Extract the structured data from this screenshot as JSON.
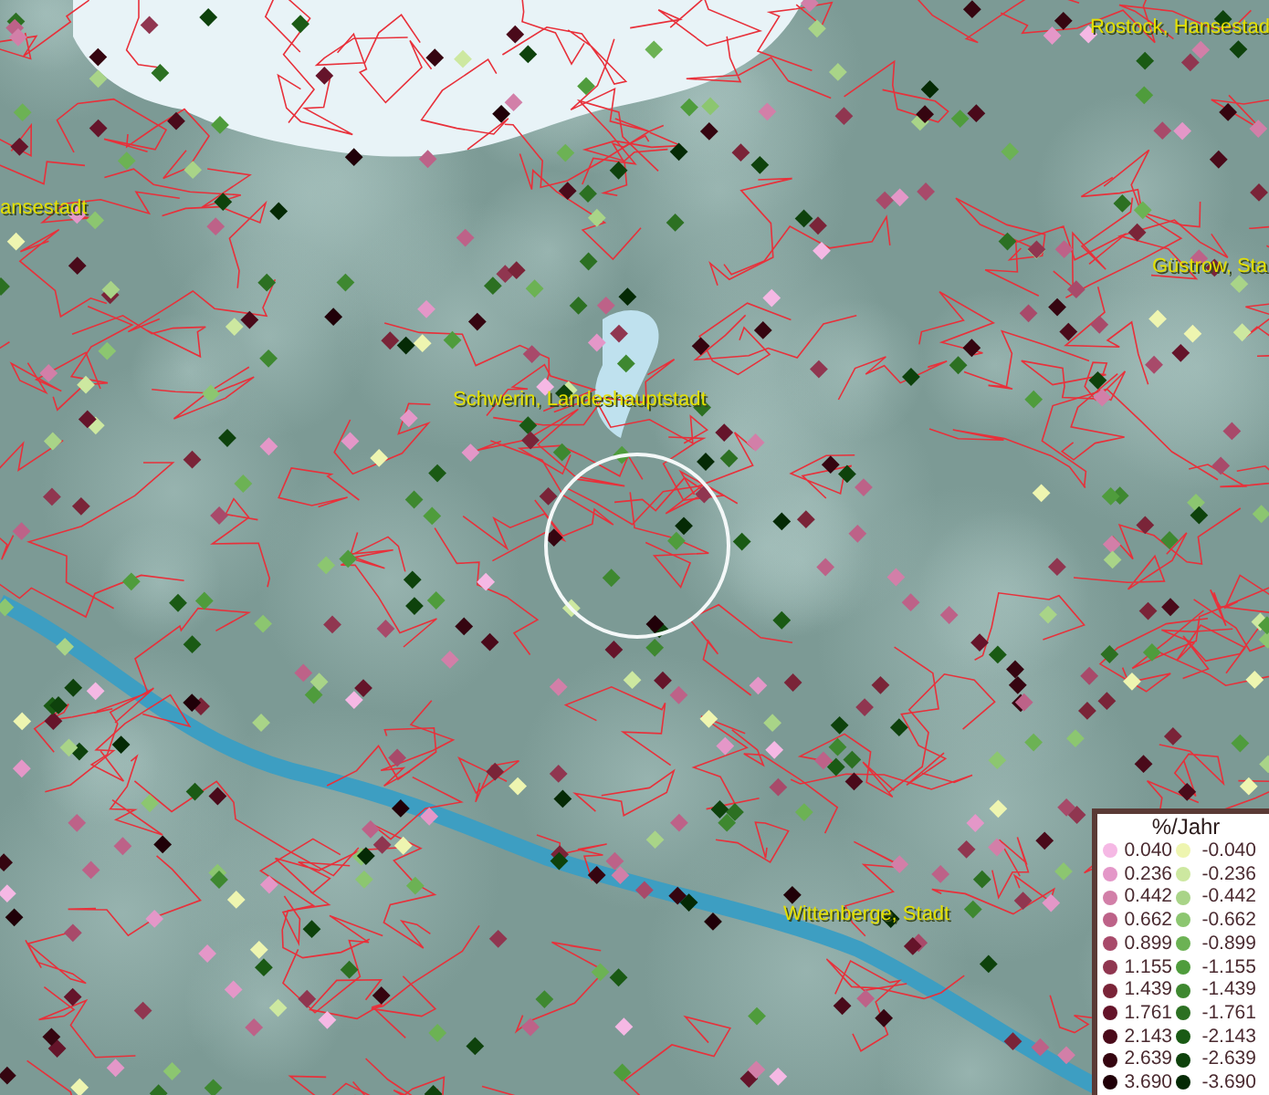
{
  "map": {
    "places": [
      {
        "name": "Rostock, Hansestad"
      },
      {
        "name": "ansestadt"
      },
      {
        "name": "Güstrow, Sta"
      },
      {
        "name": "Schwerin, Landeshauptstadt"
      },
      {
        "name": "Wittenberge, Stadt"
      }
    ]
  },
  "legend": {
    "title": "%/Jahr",
    "rows": [
      {
        "positive": {
          "value": "0.040",
          "color": "#f5b8e4"
        },
        "negative": {
          "value": "-0.040",
          "color": "#eef5b0"
        }
      },
      {
        "positive": {
          "value": "0.236",
          "color": "#e497c8"
        },
        "negative": {
          "value": "-0.236",
          "color": "#cde8a0"
        }
      },
      {
        "positive": {
          "value": "0.442",
          "color": "#d27fa8"
        },
        "negative": {
          "value": "-0.442",
          "color": "#a9d488"
        }
      },
      {
        "positive": {
          "value": "0.662",
          "color": "#bd6288"
        },
        "negative": {
          "value": "-0.662",
          "color": "#8cc670"
        }
      },
      {
        "positive": {
          "value": "0.899",
          "color": "#a84a6a"
        },
        "negative": {
          "value": "-0.899",
          "color": "#6cb254"
        }
      },
      {
        "positive": {
          "value": "1.155",
          "color": "#903650"
        },
        "negative": {
          "value": "-1.155",
          "color": "#4f9c3c"
        }
      },
      {
        "positive": {
          "value": "1.439",
          "color": "#7a2438"
        },
        "negative": {
          "value": "-1.439",
          "color": "#3e8830"
        }
      },
      {
        "positive": {
          "value": "1.761",
          "color": "#65142a"
        },
        "negative": {
          "value": "-1.761",
          "color": "#2c7022"
        }
      },
      {
        "positive": {
          "value": "2.143",
          "color": "#4a0a1a"
        },
        "negative": {
          "value": "-2.143",
          "color": "#1a5a14"
        }
      },
      {
        "positive": {
          "value": "2.639",
          "color": "#350510"
        },
        "negative": {
          "value": "-2.639",
          "color": "#0e420c"
        }
      },
      {
        "positive": {
          "value": "3.690",
          "color": "#200008"
        },
        "negative": {
          "value": "-3.690",
          "color": "#052a05"
        }
      }
    ]
  }
}
